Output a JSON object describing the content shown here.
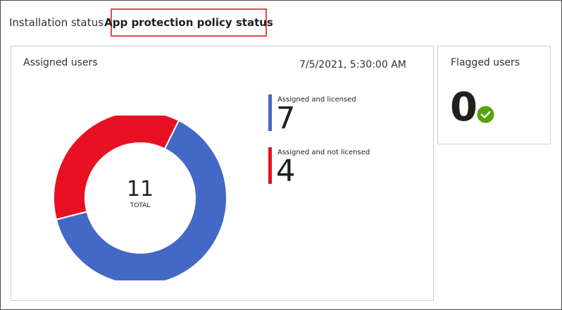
{
  "tabs": {
    "installation_label": "Installation status",
    "protection_label": "App protection policy status"
  },
  "assigned_card": {
    "title": "Assigned users",
    "timestamp": "7/5/2021, 5:30:00 AM",
    "total_value": "11",
    "total_label": "TOTAL",
    "legend": [
      {
        "label": "Assigned and licensed",
        "value": "7",
        "color": "#4468c5"
      },
      {
        "label": "Assigned and not licensed",
        "value": "4",
        "color": "#e81123"
      }
    ]
  },
  "flagged_card": {
    "title": "Flagged users",
    "value": "0",
    "status_icon": "check-circle-icon",
    "status_color": "#57a300"
  },
  "chart_data": {
    "type": "pie",
    "categories": [
      "Assigned and licensed",
      "Assigned and not licensed"
    ],
    "values": [
      7,
      4
    ],
    "colors": [
      "#4468c5",
      "#e81123"
    ],
    "total": 11,
    "center_label": "TOTAL",
    "title": "Assigned users"
  }
}
